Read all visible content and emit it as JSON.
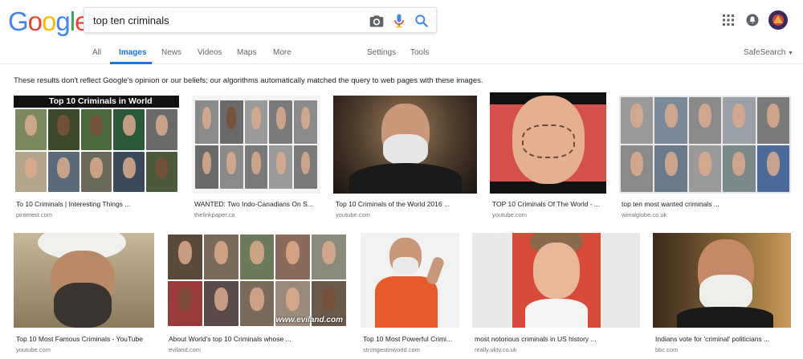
{
  "logo": {
    "letters": [
      "G",
      "o",
      "o",
      "g",
      "l",
      "e"
    ],
    "colors": [
      "#4285F4",
      "#EA4335",
      "#FBBC05",
      "#4285F4",
      "#34A853",
      "#EA4335"
    ]
  },
  "search": {
    "value": "top ten criminals"
  },
  "tabs": [
    {
      "label": "All"
    },
    {
      "label": "Images"
    },
    {
      "label": "News"
    },
    {
      "label": "Videos"
    },
    {
      "label": "Maps"
    },
    {
      "label": "More"
    },
    {
      "label": "Settings"
    },
    {
      "label": "Tools"
    }
  ],
  "safesearch": {
    "label": "SafeSearch"
  },
  "notice": "These results don't reflect Google's opinion or our beliefs; our algorithms automatically matched the query to web pages with these images.",
  "results": [
    {
      "caption": "To 10 Criminals | Interesting Things ...",
      "source": "pinterest.com",
      "overlay": "Top 10 Criminals in World"
    },
    {
      "caption": "WANTED: Two Indo-Canadians On S...",
      "source": "thelinkpaper.ca"
    },
    {
      "caption": "Top 10 Criminals of the World 2016 ...",
      "source": "youtube.com"
    },
    {
      "caption": "TOP 10 Criminals Of The World - ...",
      "source": "youtube.com"
    },
    {
      "caption": "top ten most wanted criminals ...",
      "source": "wirralglobe.co.uk"
    },
    {
      "caption": "Top 10 Most Famous Criminals - YouTube",
      "source": "youtube.com"
    },
    {
      "caption": "About World's top 10 Criminals whose ...",
      "source": "eviland.com",
      "overlay": "www.eviland.com"
    },
    {
      "caption": "Top 10 Most Powerful Crimi...",
      "source": "strongestinworld.com"
    },
    {
      "caption": "most notorious criminals in US history ...",
      "source": "really.uktv.co.uk"
    },
    {
      "caption": "Indians vote for 'criminal' politicians ...",
      "source": "bbc.com"
    }
  ]
}
